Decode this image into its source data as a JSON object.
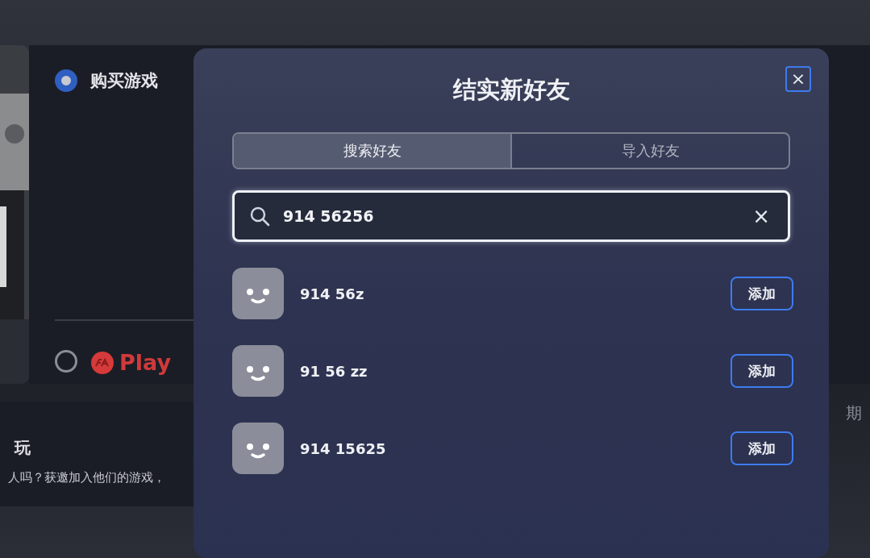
{
  "background": {
    "options": [
      {
        "label": "购买游戏",
        "kind": "text",
        "selected": true
      },
      {
        "label": "Play",
        "kind": "ea",
        "selected": false
      }
    ],
    "section_title": "玩",
    "section_text": "人吗？获邀加入他们的游戏，",
    "side_text": "期"
  },
  "dialog": {
    "title": "结实新好友",
    "close": "×",
    "tabs": [
      {
        "label": "搜索好友",
        "selected": true
      },
      {
        "label": "导入好友",
        "selected": false
      }
    ],
    "search": {
      "value": "914 56256",
      "clear": "×"
    },
    "results": [
      {
        "name": "914 56z",
        "action": "添加"
      },
      {
        "name": "91 56 zz",
        "action": "添加"
      },
      {
        "name": "914 15625",
        "action": "添加"
      }
    ]
  }
}
